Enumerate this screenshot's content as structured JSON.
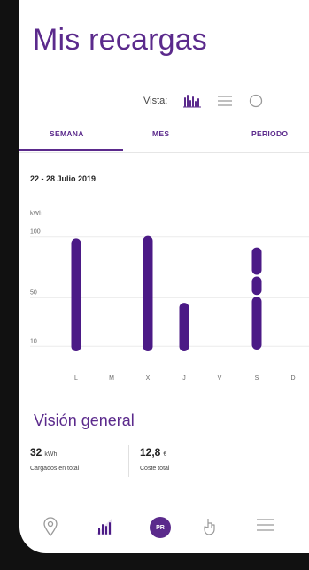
{
  "header": {
    "title": "Mis recargas"
  },
  "view": {
    "label": "Vista:",
    "options": [
      {
        "icon": "bar-chart-icon",
        "active": true
      },
      {
        "icon": "list-icon",
        "active": false
      },
      {
        "icon": "circle-icon",
        "active": false
      }
    ]
  },
  "tabs": [
    "SEMANA",
    "MES",
    "PERIODO"
  ],
  "date_range": "22 - 28 Julio 2019",
  "chart_data": {
    "type": "bar",
    "ylabel": "kWh",
    "yticks": [
      "100",
      "50",
      "10"
    ],
    "categories": [
      "L",
      "M",
      "X",
      "J",
      "V",
      "S",
      "D"
    ],
    "values": [
      93,
      0,
      95,
      40,
      0,
      93,
      0
    ],
    "segments_S": [
      24,
      18,
      45
    ],
    "ylim": [
      0,
      110
    ],
    "color": "#4b1a86"
  },
  "overview": {
    "title": "Visión general",
    "stats": [
      {
        "value": "32",
        "unit": "kWh",
        "label": "Cargados en total"
      },
      {
        "value": "12,8",
        "unit": "€",
        "label": "Coste total"
      }
    ]
  },
  "nav": {
    "items": [
      "map-pin-icon",
      "stats-icon",
      "profile-badge",
      "hand-pointer-icon",
      "menu-icon"
    ],
    "badge_text": "PR"
  },
  "colors": {
    "accent": "#5b2a8c",
    "bar": "#4b1a86"
  }
}
